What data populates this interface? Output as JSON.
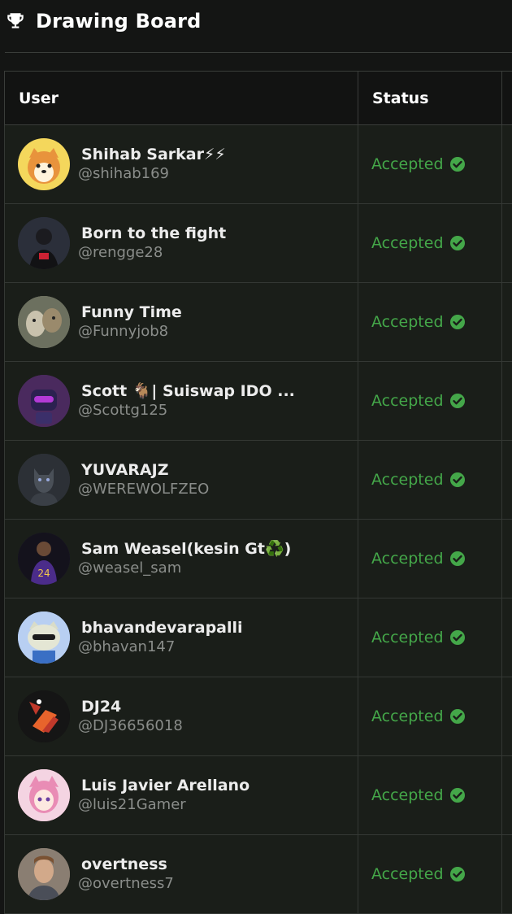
{
  "header": {
    "title": "Drawing Board",
    "icon": "trophy-icon"
  },
  "table": {
    "columns": [
      "User",
      "Status"
    ],
    "rows": [
      {
        "name": "Shihab Sarkar⚡⚡",
        "handle": "@shihab169",
        "status": "Accepted",
        "avatar": "shiba-dog-avatar",
        "avatar_color": "#f4d75c"
      },
      {
        "name": "Born to the fight",
        "handle": "@rengge28",
        "status": "Accepted",
        "avatar": "dark-portrait-avatar",
        "avatar_color": "#2b2f3a"
      },
      {
        "name": "Funny Time",
        "handle": "@Funnyjob8",
        "status": "Accepted",
        "avatar": "dogs-photo-avatar",
        "avatar_color": "#8a8c78"
      },
      {
        "name": "Scott 🐐| Suiswap IDO ...",
        "handle": "@Scottg125",
        "status": "Accepted",
        "avatar": "robot-avatar",
        "avatar_color": "#4a2a5e"
      },
      {
        "name": "YUVARAJZ",
        "handle": "@WEREWOLFZEO",
        "status": "Accepted",
        "avatar": "werewolf-avatar",
        "avatar_color": "#2c3036"
      },
      {
        "name": "Sam Weasel(kesin Gt♻️)",
        "handle": "@weasel_sam",
        "status": "Accepted",
        "avatar": "basketball-player-avatar",
        "avatar_color": "#2a2440"
      },
      {
        "name": "bhavandevarapalli",
        "handle": "@bhavan147",
        "status": "Accepted",
        "avatar": "cartoon-cat-avatar",
        "avatar_color": "#8fb3e8"
      },
      {
        "name": "DJ24",
        "handle": "@DJ36656018",
        "status": "Accepted",
        "avatar": "dj-logo-avatar",
        "avatar_color": "#151515"
      },
      {
        "name": "Luis Javier Arellano",
        "handle": "@luis21Gamer",
        "status": "Accepted",
        "avatar": "anime-girl-avatar",
        "avatar_color": "#e9a6c2"
      },
      {
        "name": "overtness",
        "handle": "@overtness7",
        "status": "Accepted",
        "avatar": "man-photo-avatar",
        "avatar_color": "#7a6a5c"
      }
    ]
  },
  "colors": {
    "accent_green": "#44a749",
    "background": "#141514",
    "row_background": "#1a1e19"
  }
}
